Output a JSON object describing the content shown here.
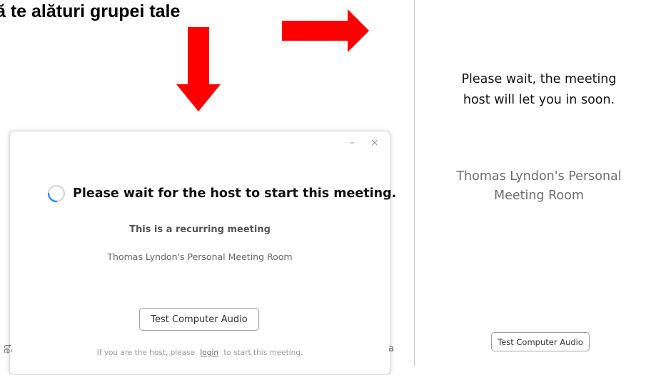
{
  "heading": {
    "text": "ă te alături grupei tale"
  },
  "colors": {
    "arrow": "#ff0000",
    "spinner_accent": "#2d8cff",
    "divider": "#c8c8c8"
  },
  "dialog": {
    "minimize_glyph": "–",
    "close_glyph": "×",
    "spinner_icon": "loading-spinner-icon",
    "wait_message": "Please wait for the host to start this meeting.",
    "recurring_note": "This is a recurring meeting",
    "room_name": "Thomas Lyndon's Personal Meeting Room",
    "test_audio_label": "Test Computer Audio",
    "host_prefix": "If you are the host, please",
    "login_label": "login",
    "host_suffix": "to start this meeting.",
    "left_fragment": "tĕ",
    "right_fragment": "a"
  },
  "right_panel": {
    "wait_message_line1": "Please wait, the meeting",
    "wait_message_line2": "host will let you in soon.",
    "room_name_line1": "Thomas Lyndon's Personal",
    "room_name_line2": "Meeting Room",
    "test_audio_label": "Test Computer Audio"
  }
}
